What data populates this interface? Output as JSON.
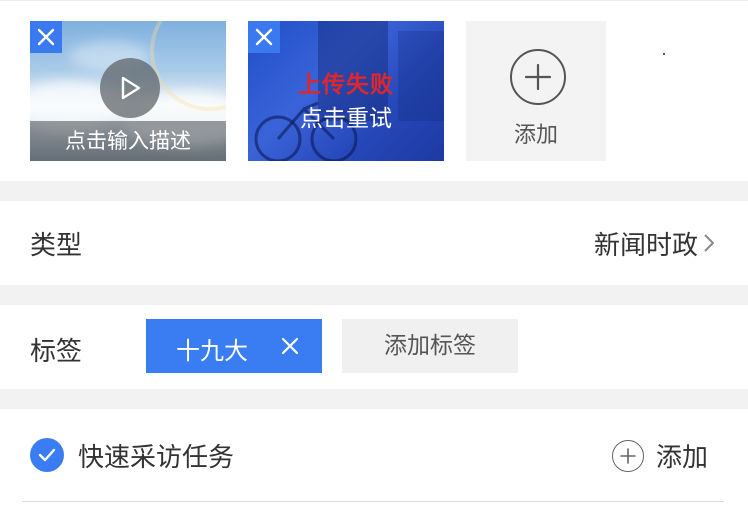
{
  "media": {
    "video_thumb": {
      "description_prompt": "点击输入描述"
    },
    "image_thumb": {
      "fail_text": "上传失败",
      "retry_text": "点击重试"
    },
    "add_tile": {
      "label": "添加"
    }
  },
  "type_row": {
    "label": "类型",
    "value": "新闻时政"
  },
  "tag_row": {
    "label": "标签",
    "tags": [
      {
        "label": "十九大"
      }
    ],
    "add_label": "添加标签"
  },
  "task_row": {
    "label": "快速采访任务",
    "checked": true,
    "add_label": "添加"
  },
  "colors": {
    "accent": "#3a7cf2",
    "error": "#e0262b",
    "background": "#f2f2f2"
  },
  "icons": {
    "remove": "close-icon",
    "play": "play-icon",
    "add_media": "plus-circle-icon",
    "chevron": "chevron-right-icon",
    "tag_remove": "close-icon",
    "task_check": "check-circle-icon",
    "task_add": "plus-circle-icon"
  }
}
